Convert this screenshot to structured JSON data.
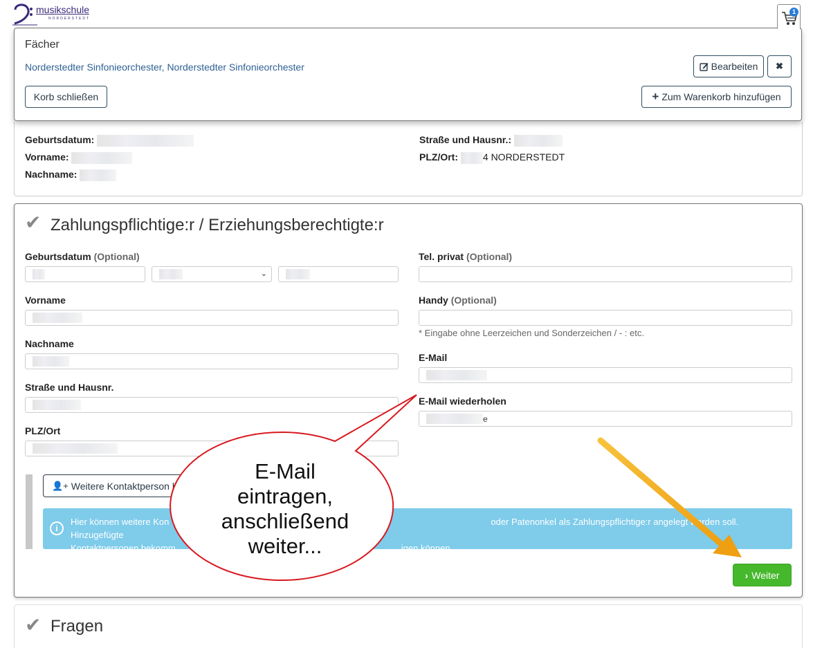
{
  "logo": {
    "line1": "musikschule",
    "line2": "NORDERSTEDT"
  },
  "cart": {
    "count": "1",
    "icon": "cart-icon"
  },
  "popover": {
    "title": "Fächer",
    "item": "Norderstedter Sinfonieorchester, Norderstedter Sinfonieorchester",
    "edit_label": "Bearbeiten",
    "remove_label": "✖",
    "close_label": "Korb schließen",
    "addcart_label": "Zum Warenkorb hinzufügen"
  },
  "student": {
    "birthdate_label": "Geburtsdatum:",
    "firstname_label": "Vorname:",
    "lastname_label": "Nachname:",
    "street_label": "Straße und Hausnr.:",
    "city_label": "PLZ/Ort:",
    "city_value": "4 NORDERSTEDT"
  },
  "payer": {
    "title": "Zahlungspflichtige:r / Erziehungsberechtigte:r",
    "birthdate_label": "Geburtsdatum",
    "optional": "(Optional)",
    "firstname_label": "Vorname",
    "lastname_label": "Nachname",
    "street_label": "Straße und Hausnr.",
    "city_label": "PLZ/Ort",
    "phone_label": "Tel. privat",
    "mobile_label": "Handy",
    "mobile_hint": "* Eingabe ohne Leerzeichen und Sonderzeichen / - : etc.",
    "email_label": "E-Mail",
    "email_repeat_label": "E-Mail wiederholen",
    "email_tail": "e",
    "add_contact_label": "Weitere Kontaktperson hin",
    "alert_line1": "Hier können weitere Kon",
    "alert_line1b": "oder Patenonkel als Zahlungspflichtige:r angelegt werden soll. Hinzugefügte",
    "alert_line2": "Kontaktpersonen bekomm",
    "alert_line2b": "igen können.",
    "next_label": "Weiter"
  },
  "questions": {
    "title": "Fragen"
  },
  "annotation": {
    "bubble_text": [
      "E-Mail",
      "eintragen,",
      "anschließend",
      "weiter..."
    ],
    "bubble_color": "#d8181f",
    "arrow_color": "#f2a81c"
  },
  "colors": {
    "link": "#2f6193",
    "alert_bg": "#7ecbea",
    "success": "#45b82b"
  }
}
